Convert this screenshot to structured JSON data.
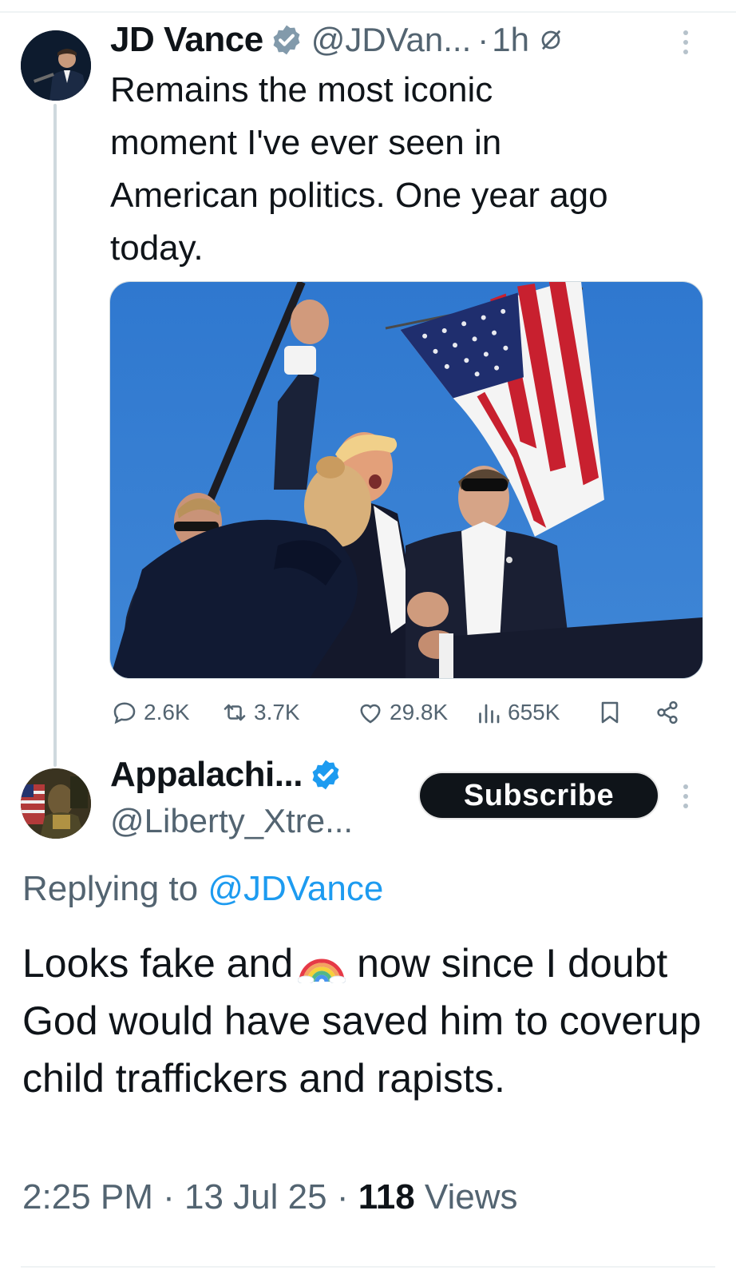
{
  "parent_tweet": {
    "display_name": "JD Vance",
    "handle": "@JDVan...",
    "separator": "·",
    "time": "1h",
    "text": "Remains the most iconic\nmoment I've ever seen in\nAmerican politics. One year ago\ntoday.",
    "media_icon": "photo",
    "actions": {
      "replies": "2.6K",
      "reposts": "3.7K",
      "likes": "29.8K",
      "views": "655K"
    }
  },
  "reply_tweet": {
    "display_name": "Appalachi...",
    "handle": "@Liberty_Xtre...",
    "subscribe_label": "Subscribe",
    "replying_prefix": "Replying to",
    "replying_mention": "@JDVance",
    "text_part1": "Looks fake and",
    "emoji_name": "rainbow-emoji",
    "text_part2": "now since I doubt God would have saved him to coverup child traffickers and rapists.",
    "meta_time": "2:25 PM",
    "meta_date": "13 Jul 25",
    "meta_separator": "·",
    "meta_views_count": "118",
    "meta_views_label": "Views"
  },
  "colors": {
    "text": "#0f1419",
    "secondary": "#536471",
    "link": "#1d9bf0",
    "verified": "#1d9bf0",
    "sky": "#2b6fc4"
  }
}
